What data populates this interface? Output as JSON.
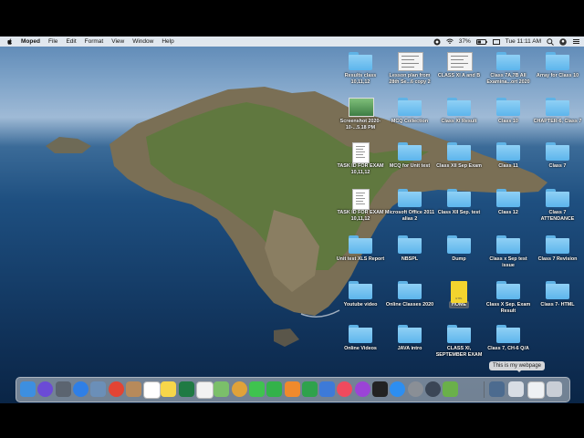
{
  "menubar": {
    "app_name": "Moped",
    "menus": [
      "File",
      "Edit",
      "Format",
      "View",
      "Window",
      "Help"
    ],
    "battery": "37%",
    "clock": "Tue 11:11 AM"
  },
  "desktop_icons": [
    {
      "label": "Results class 10,11,12",
      "kind": "folder"
    },
    {
      "label": "Lesson plan from 28th Se...6 copy 2",
      "kind": "doc-wide"
    },
    {
      "label": "CLASS XI A and B",
      "kind": "doc-wide"
    },
    {
      "label": "Class 7A,7B All Examina...ort 2020",
      "kind": "folder"
    },
    {
      "label": "Array for Class 10",
      "kind": "folder"
    },
    {
      "label": "Screenshot 2020-10-...5.18 PM",
      "kind": "screenshot"
    },
    {
      "label": "MCQ Collection",
      "kind": "folder"
    },
    {
      "label": "Class XI Result",
      "kind": "folder"
    },
    {
      "label": "Class 10",
      "kind": "folder"
    },
    {
      "label": "CHAPTER-6, Class 7",
      "kind": "folder"
    },
    {
      "label": "TASK ID FOR EXAM 10,11,12",
      "kind": "doc"
    },
    {
      "label": "MCQ for Unit test",
      "kind": "folder"
    },
    {
      "label": "Class XII Sep Exam",
      "kind": "folder"
    },
    {
      "label": "Class 11",
      "kind": "folder"
    },
    {
      "label": "Class 7",
      "kind": "folder"
    },
    {
      "label": "TASK ID FOR EXAM 10,11,12",
      "kind": "doc"
    },
    {
      "label": "Microsoft Office 2011 alias 2",
      "kind": "folder"
    },
    {
      "label": "Class XII Sep. test",
      "kind": "folder"
    },
    {
      "label": "Class 12",
      "kind": "folder"
    },
    {
      "label": "Class 7 ATTENDANCE",
      "kind": "folder"
    },
    {
      "label": "Unit test XLS Report",
      "kind": "folder"
    },
    {
      "label": "NBSPL",
      "kind": "folder"
    },
    {
      "label": "Dump",
      "kind": "folder"
    },
    {
      "label": "Class x Sep test issue",
      "kind": "folder"
    },
    {
      "label": "Class 7 Revision",
      "kind": "folder"
    },
    {
      "label": "Youtube video",
      "kind": "folder"
    },
    {
      "label": "Online Classes 2020",
      "kind": "folder"
    },
    {
      "label": "HOME",
      "kind": "html",
      "selected": true
    },
    {
      "label": "Class X Sep. Exam Result",
      "kind": "folder"
    },
    {
      "label": "Class 7- HTML",
      "kind": "folder"
    },
    {
      "label": "Online Videos",
      "kind": "folder"
    },
    {
      "label": "JAVA intro",
      "kind": "folder"
    },
    {
      "label": "CLASS XI, SEPTEMBER EXAM",
      "kind": "folder"
    },
    {
      "label": "Class 7, CH-6 Q/A",
      "kind": "folder"
    }
  ],
  "html_file_badge": "HTML",
  "dock": {
    "tooltip": "This is my webpage",
    "apps": [
      {
        "icon": "finder-icon",
        "color": "#3d8fe0"
      },
      {
        "icon": "siri-icon",
        "color": "#6b4bd6"
      },
      {
        "icon": "launchpad-icon",
        "color": "#5b6470"
      },
      {
        "icon": "safari-icon",
        "color": "#2f7fe6"
      },
      {
        "icon": "image-capture-icon",
        "color": "#6b8fb8"
      },
      {
        "icon": "chrome-icon",
        "color": "#e24434"
      },
      {
        "icon": "contacts-icon",
        "color": "#b78a5b"
      },
      {
        "icon": "calendar-icon",
        "color": "#ffffff"
      },
      {
        "icon": "notes-icon",
        "color": "#f7d64a"
      },
      {
        "icon": "excel-icon",
        "color": "#1f7a43"
      },
      {
        "icon": "reminders-icon",
        "color": "#f2f2f2"
      },
      {
        "icon": "maps-icon",
        "color": "#7bbf6a"
      },
      {
        "icon": "photos-icon",
        "color": "#e0a23a"
      },
      {
        "icon": "messages-icon",
        "color": "#3fc34f"
      },
      {
        "icon": "facetime-icon",
        "color": "#33b24a"
      },
      {
        "icon": "pages-icon",
        "color": "#f08a2c"
      },
      {
        "icon": "numbers-icon",
        "color": "#2fa24c"
      },
      {
        "icon": "keynote-icon",
        "color": "#3d7ad8"
      },
      {
        "icon": "music-icon",
        "color": "#f04a5e"
      },
      {
        "icon": "podcasts-icon",
        "color": "#9b44d6"
      },
      {
        "icon": "tv-icon",
        "color": "#222222"
      },
      {
        "icon": "app-store-icon",
        "color": "#2d8ef0"
      },
      {
        "icon": "system-preferences-icon",
        "color": "#8a8f96"
      },
      {
        "icon": "quicktime-icon",
        "color": "#3b4656"
      },
      {
        "icon": "scooter-app-icon",
        "color": "#6ab04a"
      },
      {
        "icon": "downloads-stack-icon",
        "color": "#4c6b8f"
      },
      {
        "icon": "document-stack-icon",
        "color": "#d8dde4"
      },
      {
        "icon": "webpage-stack-icon",
        "color": "#eef1f4"
      },
      {
        "icon": "trash-icon",
        "color": "#c9ced6"
      }
    ]
  }
}
